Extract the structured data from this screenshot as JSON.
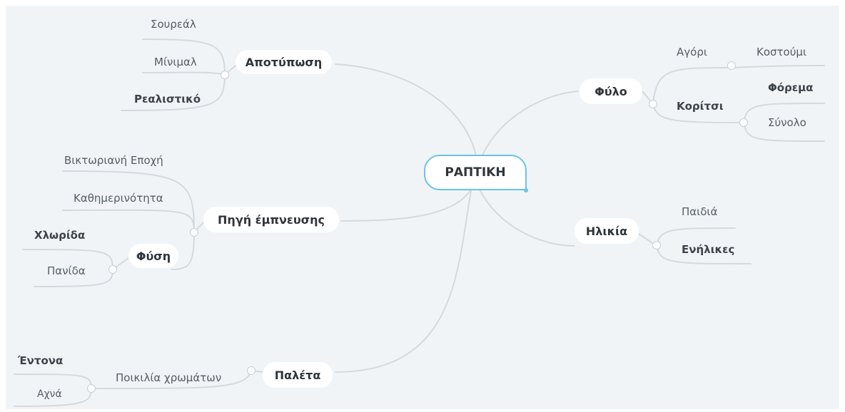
{
  "root": {
    "label": "ΡΑΠΤΙΚΗ"
  },
  "branches": {
    "apotyposi": {
      "label": "Αποτύπωση",
      "children": [
        "Σουρεάλ",
        "Μίνιμαλ",
        "Ρεαλιστικό"
      ]
    },
    "pigi": {
      "label": "Πηγή έμπνευσης",
      "children": [
        "Βικτωριανή Εποχή",
        "Καθημερινότητα"
      ],
      "fysi": {
        "label": "Φύση",
        "children": [
          "Χλωρίδα",
          "Πανίδα"
        ]
      }
    },
    "paleta": {
      "label": "Παλέτα",
      "poikilia": {
        "label": "Ποικιλία χρωμάτων",
        "children": [
          "Έντονα",
          "Αχνά"
        ]
      }
    },
    "fylo": {
      "label": "Φύλο",
      "agori": {
        "label": "Αγόρι",
        "children": [
          "Κοστούμι"
        ]
      },
      "koritsi": {
        "label": "Κορίτσι",
        "children": [
          "Φόρεμα",
          "Σύνολο"
        ]
      }
    },
    "ilikia": {
      "label": "Ηλικία",
      "children": [
        "Παιδιά",
        "Ενήλικες"
      ]
    }
  },
  "colors": {
    "background": "#f0f4f7",
    "link": "#d3dade",
    "root_border": "#6cc3e4",
    "pill": "#ffffff"
  }
}
